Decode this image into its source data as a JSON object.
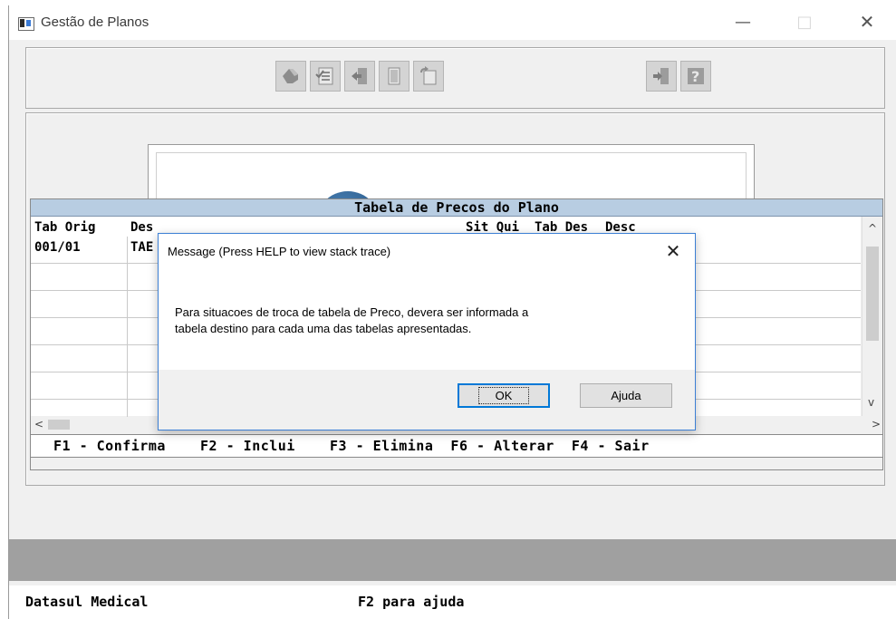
{
  "window": {
    "title": "Gestão de Planos",
    "minimize": "—",
    "maximize": "□",
    "close": "✕"
  },
  "toolbar": {
    "icons": [
      "hand-pointer-icon",
      "checklist-icon",
      "exit-door-icon",
      "copy-document-icon",
      "new-document-icon",
      "login-door-icon",
      "help-question-icon"
    ]
  },
  "table": {
    "title": "Tabela de Precos do Plano",
    "columns": [
      "Tab Orig",
      "Des",
      "Sit Qui",
      "Tab Des",
      "Desc"
    ],
    "rows": [
      {
        "tab_orig": "001/01",
        "desc": "TAE"
      }
    ],
    "scroll_left": "<",
    "scroll_right": ">",
    "scroll_up": "^",
    "scroll_down": "v"
  },
  "function_keys": "F1 - Confirma    F2 - Inclui    F3 - Elimina  F6 - Alterar  F4 - Sair",
  "status": {
    "left": "Datasul Medical",
    "center": "F2 para ajuda"
  },
  "dialog": {
    "title": "Message (Press HELP to view stack trace)",
    "close": "✕",
    "message_line1": "Para situacoes de troca de tabela de Preco,  devera ser informada a",
    "message_line2": "tabela destino para  cada uma das tabelas apresentadas.",
    "ok": "OK",
    "help": "Ajuda"
  },
  "colors": {
    "table_header": "#b8cde2",
    "dialog_border": "#3c7fd4",
    "status_gray": "#a0a0a0"
  }
}
